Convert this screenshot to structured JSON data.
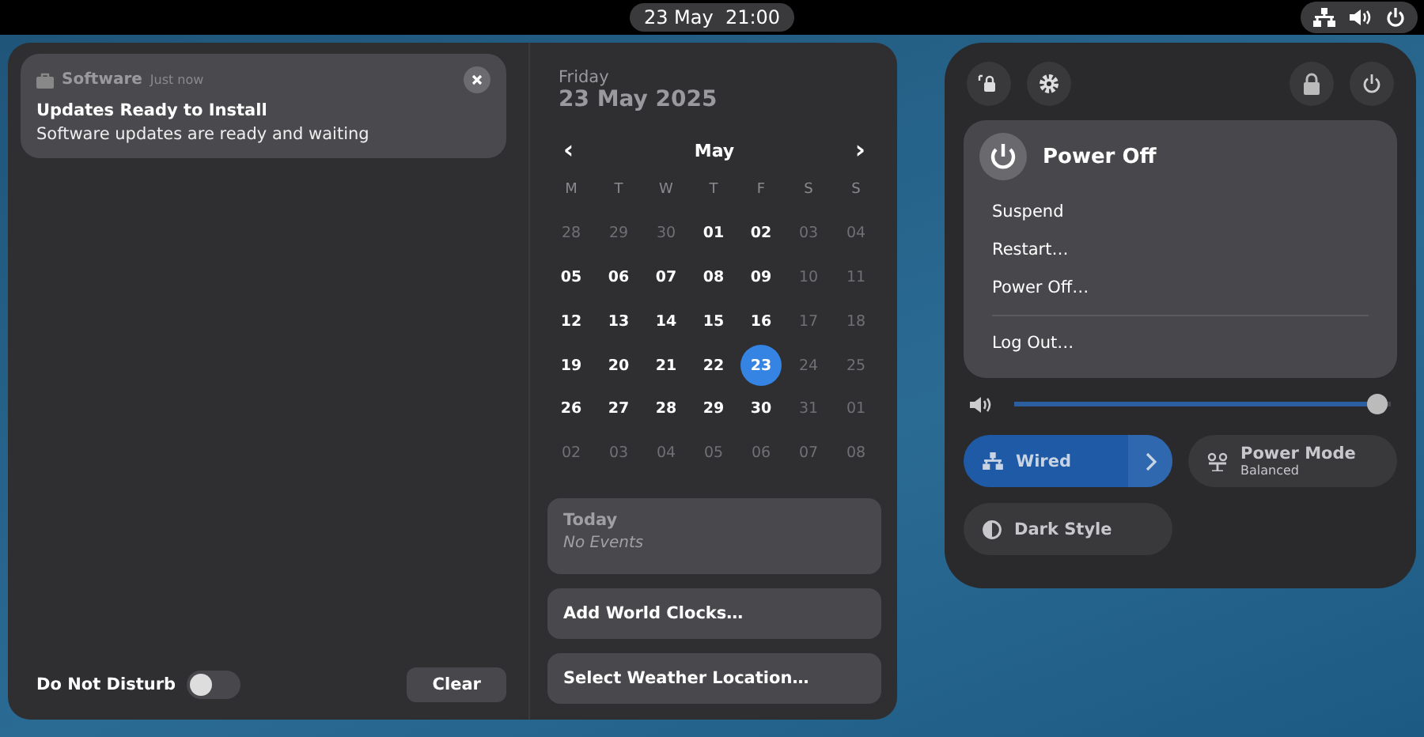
{
  "top_bar": {
    "clock": "23 May  21:00"
  },
  "notifications": [
    {
      "app": "Software",
      "time": "Just now",
      "title": "Updates Ready to Install",
      "body": "Software updates are ready and waiting"
    }
  ],
  "do_not_disturb": {
    "label": "Do Not Disturb",
    "on": false
  },
  "clear_button": "Clear",
  "date": {
    "weekday": "Friday",
    "full": "23 May 2025"
  },
  "calendar": {
    "month": "May",
    "prev": "‹",
    "next": "›",
    "weekdays": [
      "M",
      "T",
      "W",
      "T",
      "F",
      "S",
      "S"
    ],
    "weeks": [
      [
        {
          "d": "28",
          "dimmed": true,
          "selected": false
        },
        {
          "d": "29",
          "dimmed": true,
          "selected": false
        },
        {
          "d": "30",
          "dimmed": true,
          "selected": false
        },
        {
          "d": "01",
          "dimmed": false,
          "selected": false
        },
        {
          "d": "02",
          "dimmed": false,
          "selected": false
        },
        {
          "d": "03",
          "dimmed": true,
          "selected": false
        },
        {
          "d": "04",
          "dimmed": true,
          "selected": false
        }
      ],
      [
        {
          "d": "05",
          "dimmed": false,
          "selected": false
        },
        {
          "d": "06",
          "dimmed": false,
          "selected": false
        },
        {
          "d": "07",
          "dimmed": false,
          "selected": false
        },
        {
          "d": "08",
          "dimmed": false,
          "selected": false
        },
        {
          "d": "09",
          "dimmed": false,
          "selected": false
        },
        {
          "d": "10",
          "dimmed": true,
          "selected": false
        },
        {
          "d": "11",
          "dimmed": true,
          "selected": false
        }
      ],
      [
        {
          "d": "12",
          "dimmed": false,
          "selected": false
        },
        {
          "d": "13",
          "dimmed": false,
          "selected": false
        },
        {
          "d": "14",
          "dimmed": false,
          "selected": false
        },
        {
          "d": "15",
          "dimmed": false,
          "selected": false
        },
        {
          "d": "16",
          "dimmed": false,
          "selected": false
        },
        {
          "d": "17",
          "dimmed": true,
          "selected": false
        },
        {
          "d": "18",
          "dimmed": true,
          "selected": false
        }
      ],
      [
        {
          "d": "19",
          "dimmed": false,
          "selected": false
        },
        {
          "d": "20",
          "dimmed": false,
          "selected": false
        },
        {
          "d": "21",
          "dimmed": false,
          "selected": false
        },
        {
          "d": "22",
          "dimmed": false,
          "selected": false
        },
        {
          "d": "23",
          "dimmed": false,
          "selected": true
        },
        {
          "d": "24",
          "dimmed": true,
          "selected": false
        },
        {
          "d": "25",
          "dimmed": true,
          "selected": false
        }
      ],
      [
        {
          "d": "26",
          "dimmed": false,
          "selected": false
        },
        {
          "d": "27",
          "dimmed": false,
          "selected": false
        },
        {
          "d": "28",
          "dimmed": false,
          "selected": false
        },
        {
          "d": "29",
          "dimmed": false,
          "selected": false
        },
        {
          "d": "30",
          "dimmed": false,
          "selected": false
        },
        {
          "d": "31",
          "dimmed": true,
          "selected": false
        },
        {
          "d": "01",
          "dimmed": true,
          "selected": false
        }
      ],
      [
        {
          "d": "02",
          "dimmed": true,
          "selected": false
        },
        {
          "d": "03",
          "dimmed": true,
          "selected": false
        },
        {
          "d": "04",
          "dimmed": true,
          "selected": false
        },
        {
          "d": "05",
          "dimmed": true,
          "selected": false
        },
        {
          "d": "06",
          "dimmed": true,
          "selected": false
        },
        {
          "d": "07",
          "dimmed": true,
          "selected": false
        },
        {
          "d": "08",
          "dimmed": true,
          "selected": false
        }
      ]
    ]
  },
  "events": {
    "title": "Today",
    "empty": "No Events"
  },
  "world_clocks": "Add World Clocks…",
  "weather": "Select Weather Location…",
  "power_menu": {
    "title": "Power Off",
    "items": [
      {
        "label": "Suspend",
        "kind": "item"
      },
      {
        "label": "Restart…",
        "kind": "item"
      },
      {
        "label": "Power Off…",
        "kind": "item"
      },
      {
        "label": "Log Out…",
        "kind": "separated"
      }
    ]
  },
  "volume": {
    "level": 0.99
  },
  "toggles": [
    {
      "label": "Wired",
      "kind": "network",
      "on": true,
      "has_menu": true
    },
    {
      "label": "Power Mode",
      "kind": "power-mode",
      "on": false,
      "has_menu": false,
      "subtitle": "Balanced"
    },
    {
      "label": "Dark Style",
      "kind": "dark-style",
      "on": false,
      "has_menu": false
    }
  ]
}
